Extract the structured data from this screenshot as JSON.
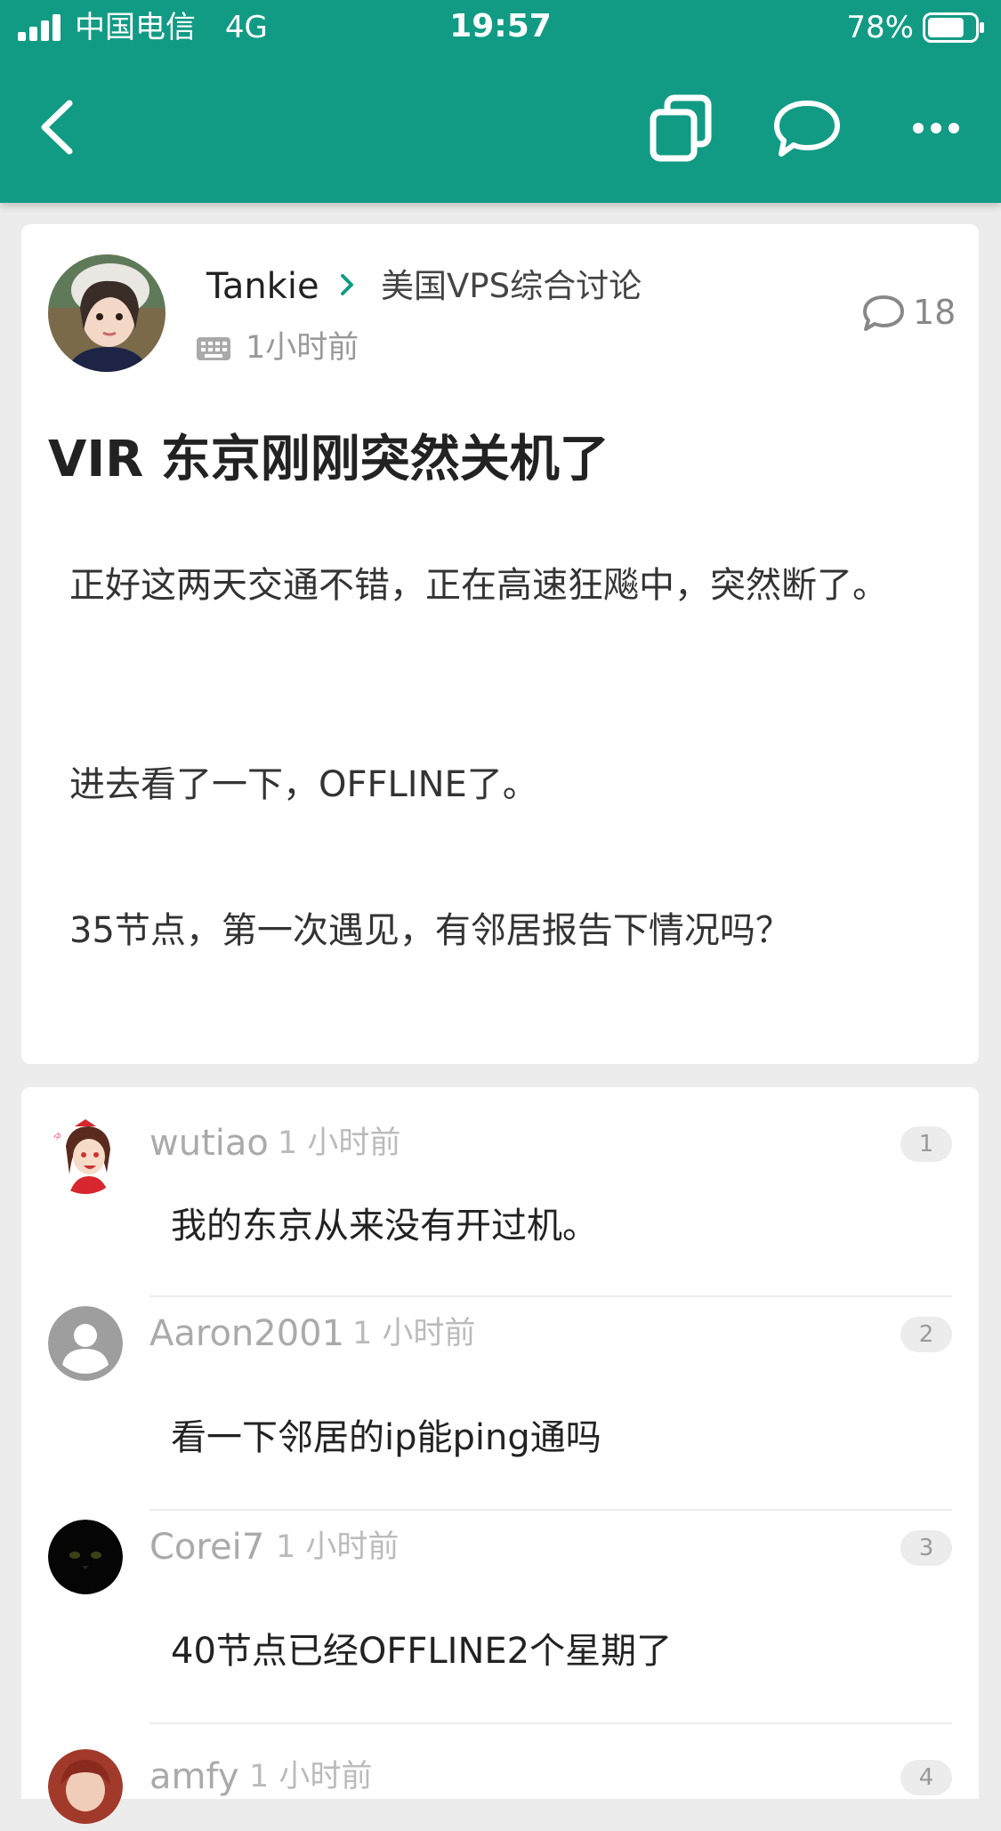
{
  "status_bar": {
    "carrier": "中国电信",
    "network": "4G",
    "time": "19:57",
    "battery_percent": "78%",
    "battery_level": 0.78
  },
  "toolbar": {
    "back_icon": "chevron-left-icon",
    "copy_icon": "copy-icon",
    "chat_icon": "chat-bubble-icon",
    "more_icon": "more-dots-icon"
  },
  "post": {
    "author": "Tankie",
    "category": "美国VPS综合讨论",
    "time": "1小时前",
    "comment_count": "18",
    "title": "VIR 东京刚刚突然关机了",
    "paragraphs": [
      "正好这两天交通不错，正在高速狂飚中，突然断了。",
      "进去看了一下，OFFLINE了。",
      "35节点，第一次遇见，有邻居报告下情况吗？"
    ]
  },
  "comments": [
    {
      "user": "wutiao",
      "time": "1 小时前",
      "floor": "1",
      "text": "我的东京从来没有开过机。"
    },
    {
      "user": "Aaron2001",
      "time": "1 小时前",
      "floor": "2",
      "text": "看一下邻居的ip能ping通吗"
    },
    {
      "user": "Corei7",
      "time": "1 小时前",
      "floor": "3",
      "text": "40节点已经OFFLINE2个星期了"
    },
    {
      "user": "amfy",
      "time": "1 小时前",
      "floor": "4",
      "text": ""
    }
  ],
  "colors": {
    "header": "#129b84",
    "accent": "#129b84",
    "background": "#ececec"
  }
}
